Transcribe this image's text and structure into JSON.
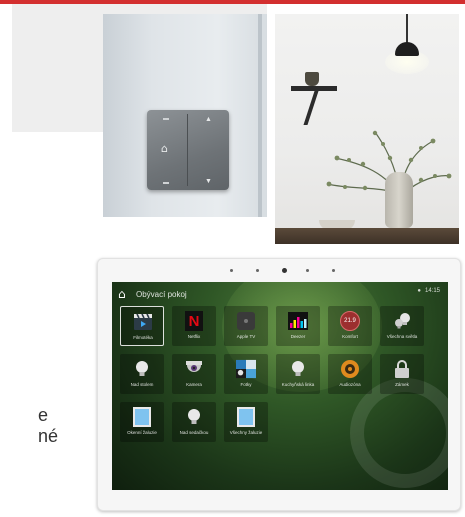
{
  "colors": {
    "accent_red": "#d32f2f",
    "screen_green": "#2f5726"
  },
  "side_text": {
    "line1": "e",
    "line2": "né"
  },
  "wall_switch": {
    "home_glyph": "⌂"
  },
  "tablet": {
    "header_title": "Obývací pokoj",
    "status": {
      "dot": "●",
      "time": "14:15"
    },
    "tiles": [
      {
        "label": "Filmotéka",
        "icon": "movie-clapper-icon"
      },
      {
        "label": "Netflix",
        "icon": "netflix-icon",
        "glyph": "N"
      },
      {
        "label": "Apple TV",
        "icon": "apple-tv-icon"
      },
      {
        "label": "Deezer",
        "icon": "deezer-icon"
      },
      {
        "label": "Komfort",
        "icon": "thermostat-icon",
        "value": "21.9"
      },
      {
        "label": "Všechna světla",
        "icon": "lights-group-icon"
      },
      {
        "label": "Nad stolem",
        "icon": "bulb-icon"
      },
      {
        "label": "Kamera",
        "icon": "camera-icon"
      },
      {
        "label": "Fotky",
        "icon": "photos-icon"
      },
      {
        "label": "Kuchyňská linka",
        "icon": "bulb-icon"
      },
      {
        "label": "Audiozóna",
        "icon": "speaker-icon"
      },
      {
        "label": "Zámek",
        "icon": "lock-icon"
      },
      {
        "label": "Okenní žaluzie",
        "icon": "window-blind-icon"
      },
      {
        "label": "Nad sedačkou",
        "icon": "bulb-icon"
      },
      {
        "label": "Všechny žaluzie",
        "icon": "window-blind-icon"
      }
    ]
  }
}
